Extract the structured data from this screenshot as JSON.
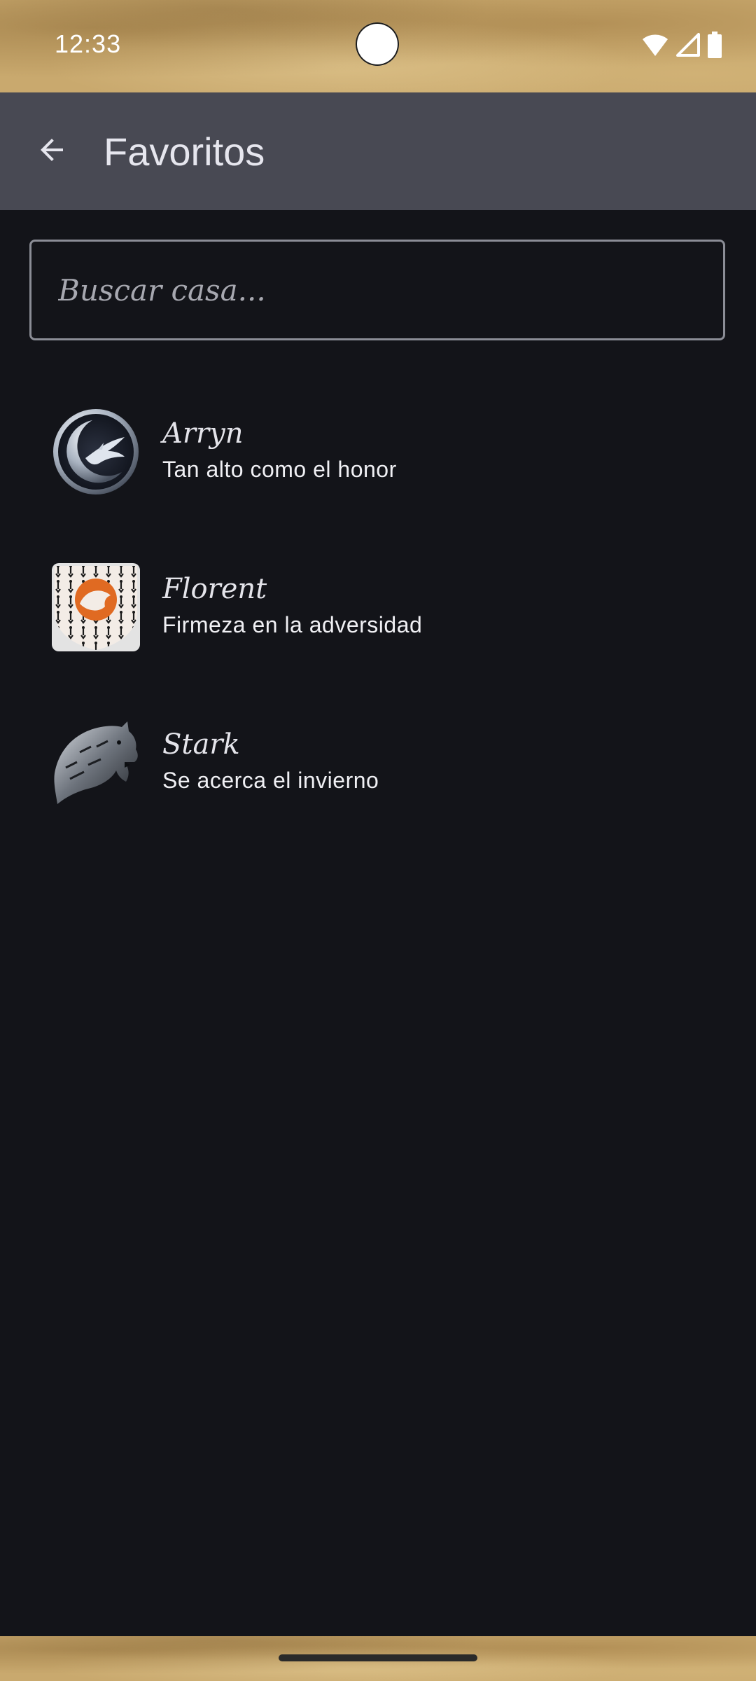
{
  "status_bar": {
    "time": "12:33"
  },
  "app_bar": {
    "title": "Favoritos",
    "back_icon": "arrow-back-icon"
  },
  "search": {
    "placeholder": "Buscar casa...",
    "value": ""
  },
  "houses": [
    {
      "name": "Arryn",
      "motto": "Tan alto como el honor",
      "crest_icon": "arryn-falcon-moon-crest"
    },
    {
      "name": "Florent",
      "motto": "Firmeza en la adversidad",
      "crest_icon": "florent-fox-crest"
    },
    {
      "name": "Stark",
      "motto": "Se acerca el invierno",
      "crest_icon": "stark-direwolf-crest"
    }
  ],
  "colors": {
    "background": "#131419",
    "app_bar": "#484953",
    "text_primary": "#e4e4ea",
    "search_border": "#8b8d96"
  }
}
